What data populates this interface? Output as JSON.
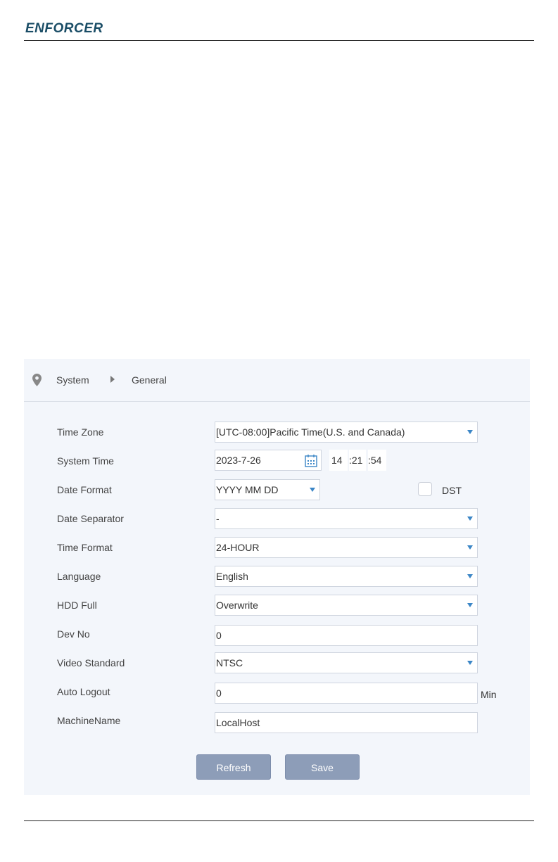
{
  "header": {
    "logo_text": "ENFORCER"
  },
  "breadcrumb": {
    "level1": "System",
    "level2": "General",
    "icon": "location-pin-icon"
  },
  "form": {
    "time_zone": {
      "label": "Time Zone",
      "value": "[UTC-08:00]Pacific Time(U.S. and Canada)"
    },
    "system_time": {
      "label": "System Time",
      "date": "2023-7-26",
      "hour": "14",
      "minute": ":21",
      "second": ":54",
      "icon": "calendar-icon"
    },
    "date_format": {
      "label": "Date Format",
      "value": "YYYY MM DD",
      "dst_label": "DST",
      "dst_checked": false
    },
    "date_separator": {
      "label": "Date Separator",
      "value": "-"
    },
    "time_format": {
      "label": "Time Format",
      "value": "24-HOUR"
    },
    "language": {
      "label": "Language",
      "value": "English"
    },
    "hdd_full": {
      "label": "HDD Full",
      "value": "Overwrite"
    },
    "dev_no": {
      "label": "Dev No",
      "value": "0"
    },
    "video_standard": {
      "label": "Video Standard",
      "value": "NTSC"
    },
    "auto_logout": {
      "label": "Auto Logout",
      "value": "0",
      "unit": "Min"
    },
    "machine_name": {
      "label": "MachineName",
      "value": "LocalHost"
    }
  },
  "buttons": {
    "refresh": "Refresh",
    "save": "Save"
  },
  "colors": {
    "accent": "#3b86c6",
    "button": "#8d9db8",
    "panel": "#f3f6fb",
    "logo": "#1a4d66"
  }
}
